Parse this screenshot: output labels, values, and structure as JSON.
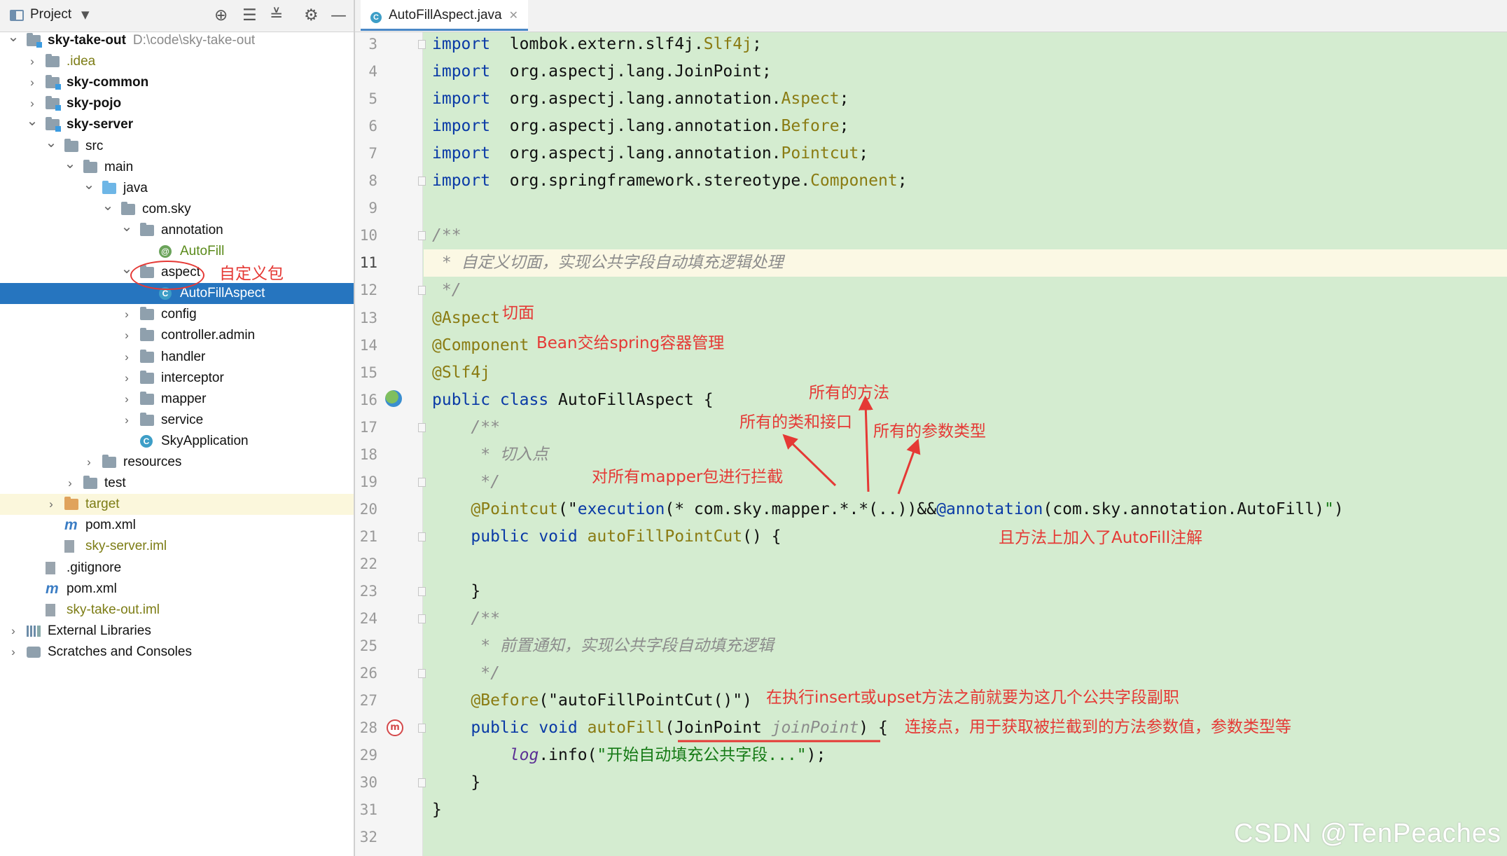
{
  "project_panel": {
    "title": "Project",
    "tree": [
      {
        "label": "sky-take-out",
        "sub": "D:\\code\\sky-take-out",
        "depth": 0,
        "arrow": "open",
        "icon": "module-folder",
        "style": "bold"
      },
      {
        "label": ".idea",
        "depth": 1,
        "arrow": "closed",
        "icon": "folder",
        "style": "olive"
      },
      {
        "label": "sky-common",
        "depth": 1,
        "arrow": "closed",
        "icon": "module-folder",
        "style": "bold"
      },
      {
        "label": "sky-pojo",
        "depth": 1,
        "arrow": "closed",
        "icon": "module-folder",
        "style": "bold"
      },
      {
        "label": "sky-server",
        "depth": 1,
        "arrow": "open",
        "icon": "module-folder",
        "style": "bold"
      },
      {
        "label": "src",
        "depth": 2,
        "arrow": "open",
        "icon": "folder"
      },
      {
        "label": "main",
        "depth": 3,
        "arrow": "open",
        "icon": "folder"
      },
      {
        "label": "java",
        "depth": 4,
        "arrow": "open",
        "icon": "blue-folder"
      },
      {
        "label": "com.sky",
        "depth": 5,
        "arrow": "open",
        "icon": "package"
      },
      {
        "label": "annotation",
        "depth": 6,
        "arrow": "open",
        "icon": "package"
      },
      {
        "label": "AutoFill",
        "depth": 7,
        "arrow": "none",
        "icon": "annotation",
        "style": "green"
      },
      {
        "label": "aspect",
        "depth": 6,
        "arrow": "open",
        "icon": "package"
      },
      {
        "label": "AutoFillAspect",
        "depth": 7,
        "arrow": "none",
        "icon": "class",
        "selected": true
      },
      {
        "label": "config",
        "depth": 6,
        "arrow": "closed",
        "icon": "package"
      },
      {
        "label": "controller.admin",
        "depth": 6,
        "arrow": "closed",
        "icon": "package"
      },
      {
        "label": "handler",
        "depth": 6,
        "arrow": "closed",
        "icon": "package"
      },
      {
        "label": "interceptor",
        "depth": 6,
        "arrow": "closed",
        "icon": "package"
      },
      {
        "label": "mapper",
        "depth": 6,
        "arrow": "closed",
        "icon": "package"
      },
      {
        "label": "service",
        "depth": 6,
        "arrow": "closed",
        "icon": "package"
      },
      {
        "label": "SkyApplication",
        "depth": 6,
        "arrow": "none",
        "icon": "spring-class"
      },
      {
        "label": "resources",
        "depth": 4,
        "arrow": "closed",
        "icon": "resources-folder"
      },
      {
        "label": "test",
        "depth": 3,
        "arrow": "closed",
        "icon": "folder"
      },
      {
        "label": "target",
        "depth": 2,
        "arrow": "closed",
        "icon": "orange-folder",
        "style": "olive",
        "yellow": true
      },
      {
        "label": "pom.xml",
        "depth": 2,
        "arrow": "none",
        "icon": "maven"
      },
      {
        "label": "sky-server.iml",
        "depth": 2,
        "arrow": "none",
        "icon": "file",
        "style": "olive"
      },
      {
        "label": ".gitignore",
        "depth": 1,
        "arrow": "none",
        "icon": "file"
      },
      {
        "label": "pom.xml",
        "depth": 1,
        "arrow": "none",
        "icon": "maven"
      },
      {
        "label": "sky-take-out.iml",
        "depth": 1,
        "arrow": "none",
        "icon": "file",
        "style": "olive"
      },
      {
        "label": "External Libraries",
        "depth": 0,
        "arrow": "closed",
        "icon": "libraries"
      },
      {
        "label": "Scratches and Consoles",
        "depth": 0,
        "arrow": "closed",
        "icon": "scratches"
      }
    ]
  },
  "editor": {
    "tab_label": "AutoFillAspect.java",
    "tab_icon_letter": "C",
    "lines": [
      {
        "n": "3",
        "fold": true,
        "tokens": [
          [
            "kw",
            "import"
          ],
          [
            "",
            "  lombok.extern.slf4j."
          ],
          [
            "an",
            "Slf4j"
          ],
          [
            "",
            ";"
          ]
        ]
      },
      {
        "n": "4",
        "tokens": [
          [
            "kw",
            "import"
          ],
          [
            "",
            "  org.aspectj.lang.JoinPoint;"
          ]
        ]
      },
      {
        "n": "5",
        "tokens": [
          [
            "kw",
            "import"
          ],
          [
            "",
            "  org.aspectj.lang.annotation."
          ],
          [
            "an",
            "Aspect"
          ],
          [
            "",
            ";"
          ]
        ]
      },
      {
        "n": "6",
        "tokens": [
          [
            "kw",
            "import"
          ],
          [
            "",
            "  org.aspectj.lang.annotation."
          ],
          [
            "an",
            "Before"
          ],
          [
            "",
            ";"
          ]
        ]
      },
      {
        "n": "7",
        "tokens": [
          [
            "kw",
            "import"
          ],
          [
            "",
            "  org.aspectj.lang.annotation."
          ],
          [
            "an",
            "Pointcut"
          ],
          [
            "",
            ";"
          ]
        ]
      },
      {
        "n": "8",
        "fold": true,
        "tokens": [
          [
            "kw",
            "import"
          ],
          [
            "",
            "  org.springframework.stereotype."
          ],
          [
            "an",
            "Component"
          ],
          [
            "",
            ";"
          ]
        ]
      },
      {
        "n": "9",
        "tokens": []
      },
      {
        "n": "10",
        "fold": true,
        "tokens": [
          [
            "cm",
            "/**"
          ]
        ]
      },
      {
        "n": "11",
        "highlight": true,
        "tokens": [
          [
            "cm",
            " * 自定义切面，实现公共字段自动填充逻辑处理"
          ]
        ]
      },
      {
        "n": "12",
        "fold": true,
        "tokens": [
          [
            "cm",
            " */"
          ]
        ]
      },
      {
        "n": "13",
        "tokens": [
          [
            "an",
            "@Aspect"
          ]
        ]
      },
      {
        "n": "14",
        "tokens": [
          [
            "an",
            "@Component"
          ]
        ]
      },
      {
        "n": "15",
        "tokens": [
          [
            "an",
            "@Slf4j"
          ]
        ]
      },
      {
        "n": "16",
        "tokens": [
          [
            "kw",
            "public class"
          ],
          [
            "",
            " AutoFillAspect {"
          ]
        ]
      },
      {
        "n": "17",
        "fold": true,
        "tokens": [
          [
            "",
            "    "
          ],
          [
            "cm",
            "/**"
          ]
        ]
      },
      {
        "n": "18",
        "tokens": [
          [
            "",
            "    "
          ],
          [
            "cm",
            " * 切入点"
          ]
        ]
      },
      {
        "n": "19",
        "fold": true,
        "tokens": [
          [
            "",
            "    "
          ],
          [
            "cm",
            " */"
          ]
        ]
      },
      {
        "n": "20",
        "tokens": [
          [
            "",
            "    "
          ],
          [
            "an",
            "@Pointcut"
          ],
          [
            "",
            "(\""
          ],
          [
            "kw",
            "execution"
          ],
          [
            "",
            "(* com.sky.mapper.*.*(..))&&"
          ],
          [
            "kw",
            "@annotation"
          ],
          [
            "",
            "(com.sky.annotation.AutoFill)"
          ],
          [
            "st",
            "\""
          ],
          [
            "",
            ")"
          ]
        ]
      },
      {
        "n": "21",
        "fold": true,
        "tokens": [
          [
            "",
            "    "
          ],
          [
            "kw",
            "public void"
          ],
          [
            "",
            ""
          ],
          [
            "ci",
            " autoFillPointCut"
          ],
          [
            "",
            "() {"
          ]
        ]
      },
      {
        "n": "22",
        "tokens": []
      },
      {
        "n": "23",
        "fold": true,
        "tokens": [
          [
            "",
            "    }"
          ]
        ]
      },
      {
        "n": "24",
        "fold": true,
        "tokens": [
          [
            "",
            "    "
          ],
          [
            "cm",
            "/**"
          ]
        ]
      },
      {
        "n": "25",
        "tokens": [
          [
            "",
            "    "
          ],
          [
            "cm",
            " * 前置通知，实现公共字段自动填充逻辑"
          ]
        ]
      },
      {
        "n": "26",
        "fold": true,
        "tokens": [
          [
            "",
            "    "
          ],
          [
            "cm",
            " */"
          ]
        ]
      },
      {
        "n": "27",
        "tokens": [
          [
            "",
            "    "
          ],
          [
            "an",
            "@Before"
          ],
          [
            "",
            "(\"autoFillPointCut()\")"
          ]
        ]
      },
      {
        "n": "28",
        "fold": true,
        "tokens": [
          [
            "",
            "    "
          ],
          [
            "kw",
            "public void"
          ],
          [
            "ci",
            " autoFill"
          ],
          [
            "",
            "(JoinPoint "
          ],
          [
            "cm",
            "joinPoint"
          ],
          [
            "",
            ") {"
          ]
        ]
      },
      {
        "n": "29",
        "tokens": [
          [
            "",
            "        "
          ],
          [
            "it",
            "log"
          ],
          [
            "",
            ".info("
          ],
          [
            "st",
            "\"开始自动填充公共字段...\""
          ],
          [
            "",
            ");"
          ]
        ]
      },
      {
        "n": "30",
        "fold": true,
        "tokens": [
          [
            "",
            "    }"
          ]
        ]
      },
      {
        "n": "31",
        "tokens": [
          [
            "",
            "}"
          ]
        ]
      },
      {
        "n": "32",
        "tokens": []
      }
    ]
  },
  "annotations": {
    "custom_package": "自定义包",
    "aspect": "切面",
    "component": "Bean交给spring容器管理",
    "all_methods": "所有的方法",
    "all_classes": "所有的类和接口",
    "all_params": "所有的参数类型",
    "intercept_mapper": "对所有mapper包进行拦截",
    "autofill_annotation": "且方法上加入了AutoFill注解",
    "before_note": "在执行insert或upset方法之前就要为这几个公共字段副职",
    "joinpoint_note": "连接点，用于获取被拦截到的方法参数值，参数类型等"
  },
  "watermark": "CSDN @TenPeaches",
  "colors": {
    "selection": "#2675bf",
    "editor_bg": "#d4ecd0",
    "annotation_red": "#e53935"
  }
}
